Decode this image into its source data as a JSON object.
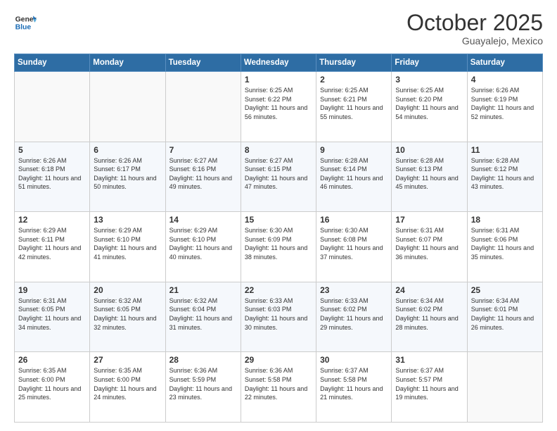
{
  "header": {
    "logo_line1": "General",
    "logo_line2": "Blue",
    "month": "October 2025",
    "location": "Guayalejo, Mexico"
  },
  "days_of_week": [
    "Sunday",
    "Monday",
    "Tuesday",
    "Wednesday",
    "Thursday",
    "Friday",
    "Saturday"
  ],
  "weeks": [
    [
      {
        "day": "",
        "info": ""
      },
      {
        "day": "",
        "info": ""
      },
      {
        "day": "",
        "info": ""
      },
      {
        "day": "1",
        "info": "Sunrise: 6:25 AM\nSunset: 6:22 PM\nDaylight: 11 hours and 56 minutes."
      },
      {
        "day": "2",
        "info": "Sunrise: 6:25 AM\nSunset: 6:21 PM\nDaylight: 11 hours and 55 minutes."
      },
      {
        "day": "3",
        "info": "Sunrise: 6:25 AM\nSunset: 6:20 PM\nDaylight: 11 hours and 54 minutes."
      },
      {
        "day": "4",
        "info": "Sunrise: 6:26 AM\nSunset: 6:19 PM\nDaylight: 11 hours and 52 minutes."
      }
    ],
    [
      {
        "day": "5",
        "info": "Sunrise: 6:26 AM\nSunset: 6:18 PM\nDaylight: 11 hours and 51 minutes."
      },
      {
        "day": "6",
        "info": "Sunrise: 6:26 AM\nSunset: 6:17 PM\nDaylight: 11 hours and 50 minutes."
      },
      {
        "day": "7",
        "info": "Sunrise: 6:27 AM\nSunset: 6:16 PM\nDaylight: 11 hours and 49 minutes."
      },
      {
        "day": "8",
        "info": "Sunrise: 6:27 AM\nSunset: 6:15 PM\nDaylight: 11 hours and 47 minutes."
      },
      {
        "day": "9",
        "info": "Sunrise: 6:28 AM\nSunset: 6:14 PM\nDaylight: 11 hours and 46 minutes."
      },
      {
        "day": "10",
        "info": "Sunrise: 6:28 AM\nSunset: 6:13 PM\nDaylight: 11 hours and 45 minutes."
      },
      {
        "day": "11",
        "info": "Sunrise: 6:28 AM\nSunset: 6:12 PM\nDaylight: 11 hours and 43 minutes."
      }
    ],
    [
      {
        "day": "12",
        "info": "Sunrise: 6:29 AM\nSunset: 6:11 PM\nDaylight: 11 hours and 42 minutes."
      },
      {
        "day": "13",
        "info": "Sunrise: 6:29 AM\nSunset: 6:10 PM\nDaylight: 11 hours and 41 minutes."
      },
      {
        "day": "14",
        "info": "Sunrise: 6:29 AM\nSunset: 6:10 PM\nDaylight: 11 hours and 40 minutes."
      },
      {
        "day": "15",
        "info": "Sunrise: 6:30 AM\nSunset: 6:09 PM\nDaylight: 11 hours and 38 minutes."
      },
      {
        "day": "16",
        "info": "Sunrise: 6:30 AM\nSunset: 6:08 PM\nDaylight: 11 hours and 37 minutes."
      },
      {
        "day": "17",
        "info": "Sunrise: 6:31 AM\nSunset: 6:07 PM\nDaylight: 11 hours and 36 minutes."
      },
      {
        "day": "18",
        "info": "Sunrise: 6:31 AM\nSunset: 6:06 PM\nDaylight: 11 hours and 35 minutes."
      }
    ],
    [
      {
        "day": "19",
        "info": "Sunrise: 6:31 AM\nSunset: 6:05 PM\nDaylight: 11 hours and 34 minutes."
      },
      {
        "day": "20",
        "info": "Sunrise: 6:32 AM\nSunset: 6:05 PM\nDaylight: 11 hours and 32 minutes."
      },
      {
        "day": "21",
        "info": "Sunrise: 6:32 AM\nSunset: 6:04 PM\nDaylight: 11 hours and 31 minutes."
      },
      {
        "day": "22",
        "info": "Sunrise: 6:33 AM\nSunset: 6:03 PM\nDaylight: 11 hours and 30 minutes."
      },
      {
        "day": "23",
        "info": "Sunrise: 6:33 AM\nSunset: 6:02 PM\nDaylight: 11 hours and 29 minutes."
      },
      {
        "day": "24",
        "info": "Sunrise: 6:34 AM\nSunset: 6:02 PM\nDaylight: 11 hours and 28 minutes."
      },
      {
        "day": "25",
        "info": "Sunrise: 6:34 AM\nSunset: 6:01 PM\nDaylight: 11 hours and 26 minutes."
      }
    ],
    [
      {
        "day": "26",
        "info": "Sunrise: 6:35 AM\nSunset: 6:00 PM\nDaylight: 11 hours and 25 minutes."
      },
      {
        "day": "27",
        "info": "Sunrise: 6:35 AM\nSunset: 6:00 PM\nDaylight: 11 hours and 24 minutes."
      },
      {
        "day": "28",
        "info": "Sunrise: 6:36 AM\nSunset: 5:59 PM\nDaylight: 11 hours and 23 minutes."
      },
      {
        "day": "29",
        "info": "Sunrise: 6:36 AM\nSunset: 5:58 PM\nDaylight: 11 hours and 22 minutes."
      },
      {
        "day": "30",
        "info": "Sunrise: 6:37 AM\nSunset: 5:58 PM\nDaylight: 11 hours and 21 minutes."
      },
      {
        "day": "31",
        "info": "Sunrise: 6:37 AM\nSunset: 5:57 PM\nDaylight: 11 hours and 19 minutes."
      },
      {
        "day": "",
        "info": ""
      }
    ]
  ]
}
